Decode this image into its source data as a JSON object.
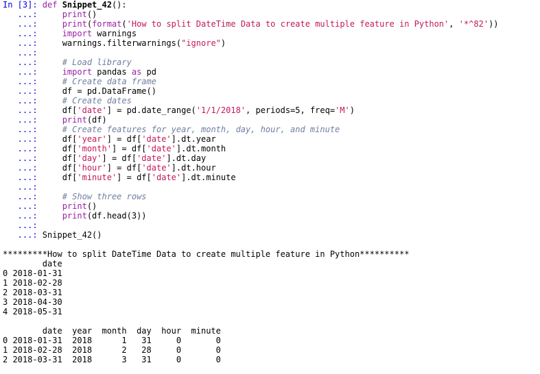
{
  "prompt_in": "In [3]: ",
  "prompt_cont": "   ...: ",
  "code_lines": [
    [
      {
        "t": "def ",
        "c": "kw"
      },
      {
        "t": "Snippet_42",
        "c": "fn"
      },
      {
        "t": "():",
        "c": ""
      }
    ],
    [
      {
        "t": "    ",
        "c": ""
      },
      {
        "t": "print",
        "c": "kw"
      },
      {
        "t": "()",
        "c": ""
      }
    ],
    [
      {
        "t": "    ",
        "c": ""
      },
      {
        "t": "print",
        "c": "kw"
      },
      {
        "t": "(",
        "c": ""
      },
      {
        "t": "format",
        "c": "kw"
      },
      {
        "t": "(",
        "c": ""
      },
      {
        "t": "'How to split DateTime Data to create multiple feature in Python'",
        "c": "str"
      },
      {
        "t": ", ",
        "c": ""
      },
      {
        "t": "'*^82'",
        "c": "str"
      },
      {
        "t": "))",
        "c": ""
      }
    ],
    [
      {
        "t": "    ",
        "c": ""
      },
      {
        "t": "import",
        "c": "kw"
      },
      {
        "t": " warnings",
        "c": ""
      }
    ],
    [
      {
        "t": "    warnings.filterwarnings(",
        "c": ""
      },
      {
        "t": "\"ignore\"",
        "c": "str"
      },
      {
        "t": ")",
        "c": ""
      }
    ],
    [],
    [
      {
        "t": "    ",
        "c": ""
      },
      {
        "t": "# Load library",
        "c": "cm"
      }
    ],
    [
      {
        "t": "    ",
        "c": ""
      },
      {
        "t": "import",
        "c": "kw"
      },
      {
        "t": " pandas ",
        "c": ""
      },
      {
        "t": "as",
        "c": "kw"
      },
      {
        "t": " pd",
        "c": ""
      }
    ],
    [
      {
        "t": "    ",
        "c": ""
      },
      {
        "t": "# Create data frame",
        "c": "cm"
      }
    ],
    [
      {
        "t": "    df = pd.DataFrame()",
        "c": ""
      }
    ],
    [
      {
        "t": "    ",
        "c": ""
      },
      {
        "t": "# Create dates",
        "c": "cm"
      }
    ],
    [
      {
        "t": "    df[",
        "c": ""
      },
      {
        "t": "'date'",
        "c": "str"
      },
      {
        "t": "] = pd.date_range(",
        "c": ""
      },
      {
        "t": "'1/1/2018'",
        "c": "str"
      },
      {
        "t": ", periods=5, freq=",
        "c": ""
      },
      {
        "t": "'M'",
        "c": "str"
      },
      {
        "t": ")",
        "c": ""
      }
    ],
    [
      {
        "t": "    ",
        "c": ""
      },
      {
        "t": "print",
        "c": "kw"
      },
      {
        "t": "(df)",
        "c": ""
      }
    ],
    [
      {
        "t": "    ",
        "c": ""
      },
      {
        "t": "# Create features for year, month, day, hour, and minute",
        "c": "cm"
      }
    ],
    [
      {
        "t": "    df[",
        "c": ""
      },
      {
        "t": "'year'",
        "c": "str"
      },
      {
        "t": "] = df[",
        "c": ""
      },
      {
        "t": "'date'",
        "c": "str"
      },
      {
        "t": "].dt.year",
        "c": ""
      }
    ],
    [
      {
        "t": "    df[",
        "c": ""
      },
      {
        "t": "'month'",
        "c": "str"
      },
      {
        "t": "] = df[",
        "c": ""
      },
      {
        "t": "'date'",
        "c": "str"
      },
      {
        "t": "].dt.month",
        "c": ""
      }
    ],
    [
      {
        "t": "    df[",
        "c": ""
      },
      {
        "t": "'day'",
        "c": "str"
      },
      {
        "t": "] = df[",
        "c": ""
      },
      {
        "t": "'date'",
        "c": "str"
      },
      {
        "t": "].dt.day",
        "c": ""
      }
    ],
    [
      {
        "t": "    df[",
        "c": ""
      },
      {
        "t": "'hour'",
        "c": "str"
      },
      {
        "t": "] = df[",
        "c": ""
      },
      {
        "t": "'date'",
        "c": "str"
      },
      {
        "t": "].dt.hour",
        "c": ""
      }
    ],
    [
      {
        "t": "    df[",
        "c": ""
      },
      {
        "t": "'minute'",
        "c": "str"
      },
      {
        "t": "] = df[",
        "c": ""
      },
      {
        "t": "'date'",
        "c": "str"
      },
      {
        "t": "].dt.minute",
        "c": ""
      }
    ],
    [],
    [
      {
        "t": "    ",
        "c": ""
      },
      {
        "t": "# Show three rows",
        "c": "cm"
      }
    ],
    [
      {
        "t": "    ",
        "c": ""
      },
      {
        "t": "print",
        "c": "kw"
      },
      {
        "t": "()",
        "c": ""
      }
    ],
    [
      {
        "t": "    ",
        "c": ""
      },
      {
        "t": "print",
        "c": "kw"
      },
      {
        "t": "(df.head(3))",
        "c": ""
      }
    ],
    [],
    [
      {
        "t": "Snippet_42()",
        "c": ""
      }
    ]
  ],
  "output_lines": [
    "",
    "*********How to split DateTime Data to create multiple feature in Python**********",
    "        date",
    "0 2018-01-31",
    "1 2018-02-28",
    "2 2018-03-31",
    "3 2018-04-30",
    "4 2018-05-31",
    "",
    "        date  year  month  day  hour  minute",
    "0 2018-01-31  2018      1   31     0       0",
    "1 2018-02-28  2018      2   28     0       0",
    "2 2018-03-31  2018      3   31     0       0"
  ],
  "colors": {
    "prompt": "#0000e6",
    "keyword": "#9a1ea6",
    "comment": "#6f7fa0",
    "string": "#c2185b",
    "text": "#000000",
    "background": "#ffffff"
  }
}
